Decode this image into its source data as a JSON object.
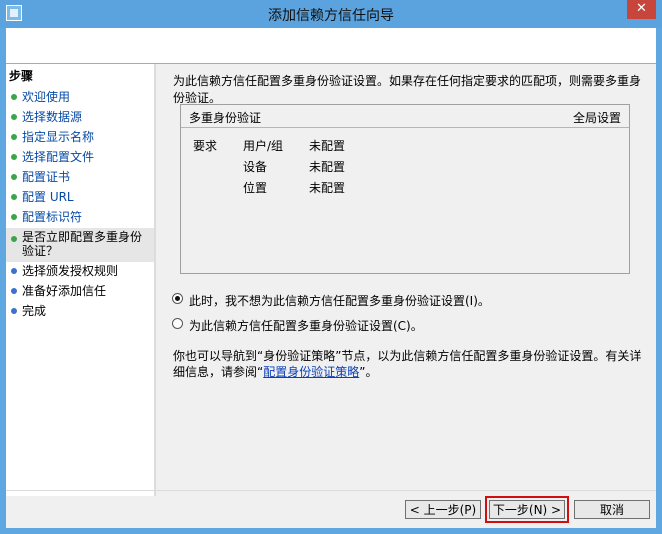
{
  "window": {
    "title": "添加信赖方信任向导",
    "close_glyph": "✕",
    "app_icon": "wizard-app-icon"
  },
  "sidebar": {
    "title": "步骤",
    "items": [
      {
        "label": "欢迎使用",
        "state": "done"
      },
      {
        "label": "选择数据源",
        "state": "done"
      },
      {
        "label": "指定显示名称",
        "state": "done"
      },
      {
        "label": "选择配置文件",
        "state": "done"
      },
      {
        "label": "配置证书",
        "state": "done"
      },
      {
        "label": "配置 URL",
        "state": "done"
      },
      {
        "label": "配置标识符",
        "state": "done"
      },
      {
        "label": "是否立即配置多重身份验证？",
        "state": "current"
      },
      {
        "label": "选择颁发授权规则",
        "state": "pending"
      },
      {
        "label": "准备好添加信任",
        "state": "pending"
      },
      {
        "label": "完成",
        "state": "pending"
      }
    ]
  },
  "main": {
    "description": "为此信赖方信任配置多重身份验证设置。如果存在任何指定要求的匹配项，则需要多重身份验证。",
    "mfa": {
      "header_left": "多重身份验证",
      "header_right": "全局设置",
      "req_label": "要求",
      "rows": [
        {
          "name": "用户/组",
          "value": "未配置"
        },
        {
          "name": "设备",
          "value": "未配置"
        },
        {
          "name": "位置",
          "value": "未配置"
        }
      ]
    },
    "option_no": "此时，我不想为此信赖方信任配置多重身份验证设置(I)。",
    "option_yes": "为此信赖方信任配置多重身份验证设置(C)。",
    "selected_option": "option_no",
    "info_prefix": "你也可以导航到“身份验证策略”节点，以为此信赖方信任配置多重身份验证设置。有关详细信息，请参阅“",
    "info_link": "配置身份验证策略",
    "info_suffix": "”。"
  },
  "buttons": {
    "prev": "< 上一步(P)",
    "next": "下一步(N) >",
    "cancel": "取消"
  }
}
